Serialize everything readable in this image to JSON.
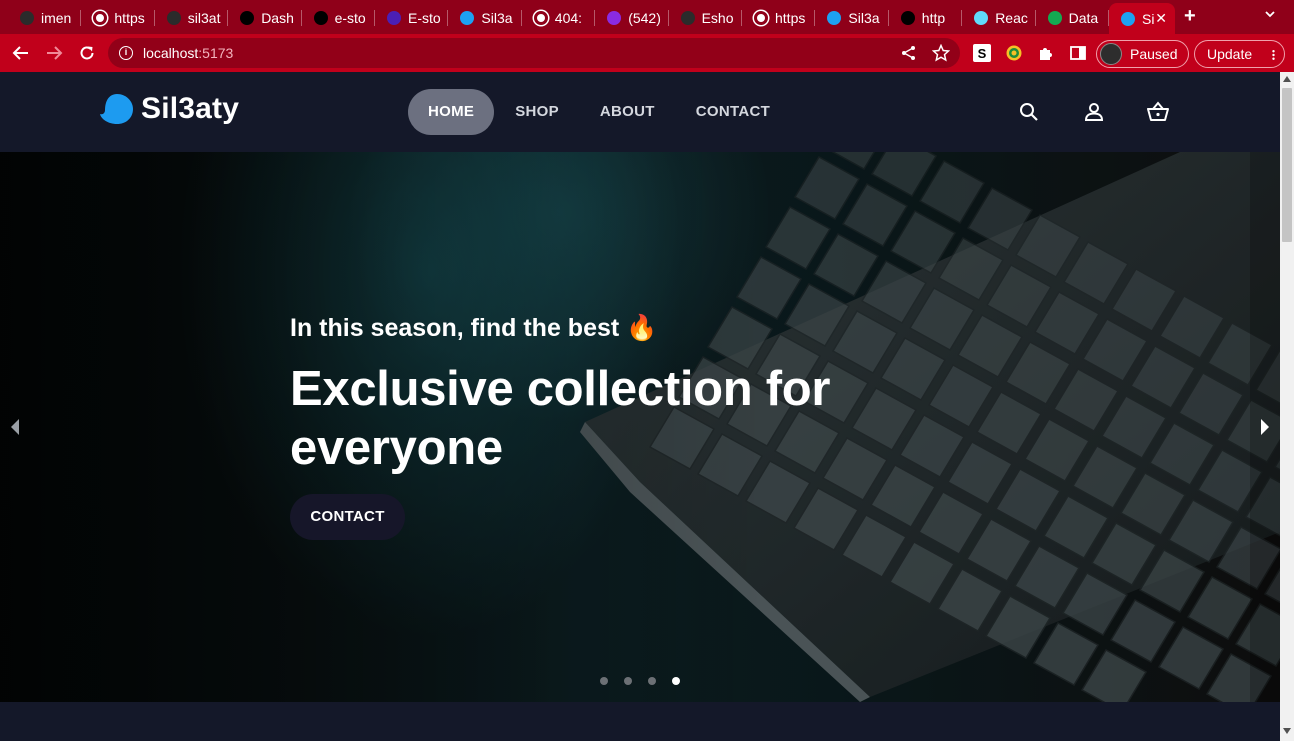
{
  "browser": {
    "tabs": [
      {
        "title": "imen",
        "favicon": "github-icon",
        "color": "#2b2b2b"
      },
      {
        "title": "https",
        "favicon": "globe-icon",
        "color": "#ffffff"
      },
      {
        "title": "sil3at",
        "favicon": "github-icon",
        "color": "#2b2b2b"
      },
      {
        "title": "Dash",
        "favicon": "vercel-icon",
        "color": "#000000"
      },
      {
        "title": "e-sto",
        "favicon": "vercel-icon",
        "color": "#000000"
      },
      {
        "title": "E-sto",
        "favicon": "cart-icon",
        "color": "#4b1fb5"
      },
      {
        "title": "Sil3a",
        "favicon": "sil3aty-icon",
        "color": "#1da1f2"
      },
      {
        "title": "404:",
        "favicon": "globe-icon",
        "color": "#ffffff"
      },
      {
        "title": "(542)",
        "favicon": "mail-icon",
        "color": "#8a2be2"
      },
      {
        "title": "Esho",
        "favicon": "github-icon",
        "color": "#2b2b2b"
      },
      {
        "title": "https",
        "favicon": "globe-icon",
        "color": "#ffffff"
      },
      {
        "title": "Sil3a",
        "favicon": "sil3aty-icon",
        "color": "#1da1f2"
      },
      {
        "title": "http",
        "favicon": "vercel-icon",
        "color": "#000000"
      },
      {
        "title": "Reac",
        "favicon": "react-icon",
        "color": "#61dafb"
      },
      {
        "title": "Data",
        "favicon": "mongodb-icon",
        "color": "#13aa52"
      },
      {
        "title": "Si",
        "favicon": "sil3aty-icon",
        "color": "#1da1f2",
        "active": true
      }
    ],
    "url_host": "localhost",
    "url_port": ":5173",
    "profile_label": "Paused",
    "update_label": "Update"
  },
  "nav": {
    "brand": "Sil3aty",
    "links": [
      {
        "label": "HOME",
        "active": true
      },
      {
        "label": "SHOP",
        "active": false
      },
      {
        "label": "ABOUT",
        "active": false
      },
      {
        "label": "CONTACT",
        "active": false
      }
    ],
    "icons": [
      "search-icon",
      "user-icon",
      "cart-icon"
    ]
  },
  "hero": {
    "eyebrow": "In this season, find the best 🔥",
    "headline": "Exclusive collection for everyone",
    "cta": "CONTACT",
    "slide_count": 4,
    "active_slide": 4
  },
  "colors": {
    "chrome_tabbar": "#8f0019",
    "chrome_toolbar": "#c1001b",
    "page_bg": "#141829",
    "brand_blue": "#1d9bf0",
    "nav_active": "#6c7080"
  }
}
